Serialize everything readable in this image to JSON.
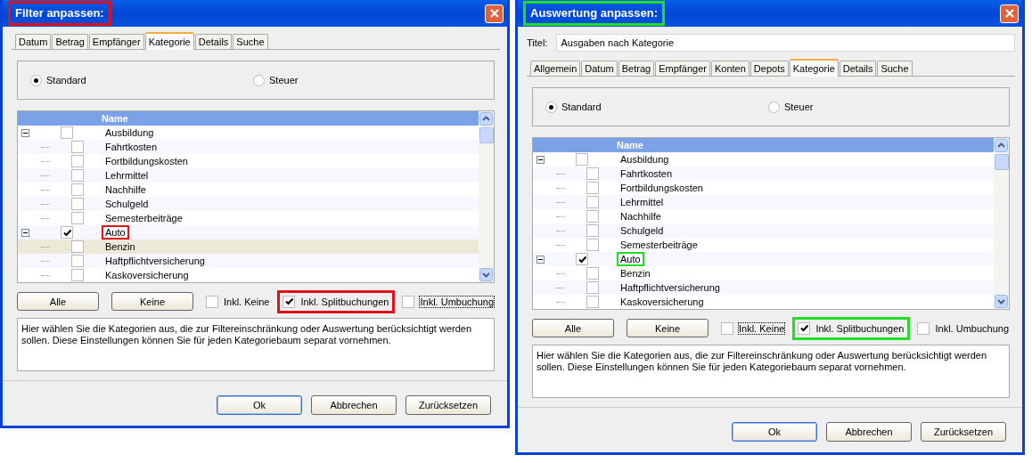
{
  "dialogs": [
    {
      "title": "Filter anpassen:",
      "color": "#e0101a",
      "title_highlighted": true,
      "tabs": [
        {
          "label": "Datum",
          "selected": false
        },
        {
          "label": "Betrag",
          "selected": false
        },
        {
          "label": "Empfänger",
          "selected": false
        },
        {
          "label": "Kategorie",
          "selected": true
        },
        {
          "label": "Details",
          "selected": false
        },
        {
          "label": "Suche",
          "selected": false
        }
      ],
      "radios": [
        {
          "label": "Standard",
          "selected": true
        },
        {
          "label": "Steuer",
          "selected": false
        }
      ],
      "tree": {
        "column": "Name",
        "items": [
          {
            "label": "Ausbildung",
            "checked": false,
            "expanded": true,
            "selected": false,
            "highlighted": false,
            "children": [
              {
                "label": "Fahrtkosten",
                "checked": false,
                "selected": false,
                "highlighted": false
              },
              {
                "label": "Fortbildungskosten",
                "checked": false,
                "selected": false,
                "highlighted": false
              },
              {
                "label": "Lehrmittel",
                "checked": false,
                "selected": false,
                "highlighted": false
              },
              {
                "label": "Nachhilfe",
                "checked": false,
                "selected": false,
                "highlighted": false
              },
              {
                "label": "Schulgeld",
                "checked": false,
                "selected": false,
                "highlighted": false
              },
              {
                "label": "Semesterbeiträge",
                "checked": false,
                "selected": false,
                "highlighted": false
              }
            ]
          },
          {
            "label": "Auto",
            "checked": true,
            "expanded": true,
            "selected": false,
            "highlighted": true,
            "children": [
              {
                "label": "Benzin",
                "checked": false,
                "selected": true,
                "highlighted": false
              },
              {
                "label": "Haftpflichtversicherung",
                "checked": false,
                "selected": false,
                "highlighted": false
              },
              {
                "label": "Kaskoversicherung",
                "checked": false,
                "selected": false,
                "highlighted": false
              }
            ]
          }
        ]
      },
      "actions": [
        "Alle",
        "Keine"
      ],
      "options": [
        {
          "label": "Inkl. Keine",
          "checked": false,
          "focused": false,
          "highlighted": false
        },
        {
          "label": "Inkl. Splitbuchungen",
          "checked": true,
          "focused": false,
          "highlighted": true
        },
        {
          "label": "Inkl. Umbuchung",
          "checked": false,
          "focused": true,
          "highlighted": false
        }
      ],
      "hint": "Hier wählen Sie die Kategorien aus, die zur Filtereinschränkung oder Auswertung berücksichtigt werden sollen. Diese Einstellungen können Sie für jeden Kategoriebaum separat vornehmen.",
      "buttons": [
        {
          "label": "Ok",
          "default": true
        },
        {
          "label": "Abbrechen",
          "default": false
        },
        {
          "label": "Zurücksetzen",
          "default": false
        }
      ]
    },
    {
      "title": "Auswertung anpassen:",
      "color": "#22dd22",
      "title_highlighted": true,
      "field": {
        "label": "Titel:",
        "value": "Ausgaben nach Kategorie"
      },
      "tabs": [
        {
          "label": "Allgemein",
          "selected": false
        },
        {
          "label": "Datum",
          "selected": false
        },
        {
          "label": "Betrag",
          "selected": false
        },
        {
          "label": "Empfänger",
          "selected": false
        },
        {
          "label": "Konten",
          "selected": false
        },
        {
          "label": "Depots",
          "selected": false
        },
        {
          "label": "Kategorie",
          "selected": true
        },
        {
          "label": "Details",
          "selected": false
        },
        {
          "label": "Suche",
          "selected": false
        }
      ],
      "radios": [
        {
          "label": "Standard",
          "selected": true
        },
        {
          "label": "Steuer",
          "selected": false
        }
      ],
      "tree": {
        "column": "Name",
        "items": [
          {
            "label": "Ausbildung",
            "checked": false,
            "expanded": true,
            "selected": false,
            "highlighted": false,
            "children": [
              {
                "label": "Fahrtkosten",
                "checked": false,
                "selected": false,
                "highlighted": false
              },
              {
                "label": "Fortbildungskosten",
                "checked": false,
                "selected": false,
                "highlighted": false
              },
              {
                "label": "Lehrmittel",
                "checked": false,
                "selected": false,
                "highlighted": false
              },
              {
                "label": "Nachhilfe",
                "checked": false,
                "selected": false,
                "highlighted": false
              },
              {
                "label": "Schulgeld",
                "checked": false,
                "selected": false,
                "highlighted": false
              },
              {
                "label": "Semesterbeiträge",
                "checked": false,
                "selected": false,
                "highlighted": false
              }
            ]
          },
          {
            "label": "Auto",
            "checked": true,
            "expanded": true,
            "selected": false,
            "highlighted": true,
            "children": [
              {
                "label": "Benzin",
                "checked": false,
                "selected": false,
                "highlighted": false
              },
              {
                "label": "Haftpflichtversicherung",
                "checked": false,
                "selected": false,
                "highlighted": false
              },
              {
                "label": "Kaskoversicherung",
                "checked": false,
                "selected": false,
                "highlighted": false
              }
            ]
          }
        ]
      },
      "actions": [
        "Alle",
        "Keine"
      ],
      "options": [
        {
          "label": "Inkl. Keine",
          "checked": false,
          "focused": true,
          "highlighted": false
        },
        {
          "label": "Inkl. Splitbuchungen",
          "checked": true,
          "focused": false,
          "highlighted": true
        },
        {
          "label": "Inkl. Umbuchung",
          "checked": false,
          "focused": false,
          "highlighted": false
        }
      ],
      "hint": "Hier wählen Sie die Kategorien aus, die zur Filtereinschränkung oder Auswertung berücksichtigt werden sollen. Diese Einstellungen können Sie für jeden Kategoriebaum separat vornehmen.",
      "buttons": [
        {
          "label": "Ok",
          "default": true
        },
        {
          "label": "Abbrechen",
          "default": false
        },
        {
          "label": "Zurücksetzen",
          "default": false
        }
      ]
    }
  ]
}
